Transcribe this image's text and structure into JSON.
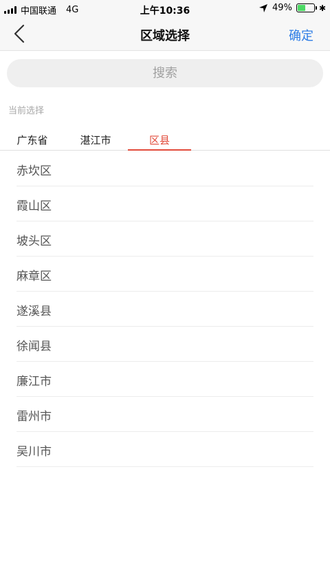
{
  "status_bar": {
    "carrier": "中国联通",
    "network": "4G",
    "time": "上午10:36",
    "battery": "49%",
    "battery_level": 0.49,
    "bluetooth": "✱"
  },
  "nav": {
    "title": "区域选择",
    "confirm_label": "确定",
    "back_icon": "chevron-left-icon"
  },
  "search": {
    "placeholder": "搜索",
    "value": ""
  },
  "section_label": "当前选择",
  "tabs": [
    {
      "label": "广东省",
      "active": false
    },
    {
      "label": "湛江市",
      "active": false
    },
    {
      "label": "区县",
      "active": true
    }
  ],
  "districts": [
    "赤坎区",
    "霞山区",
    "坡头区",
    "麻章区",
    "遂溪县",
    "徐闻县",
    "廉江市",
    "雷州市",
    "吴川市"
  ],
  "colors": {
    "accent_red": "#e24b3b",
    "confirm_blue": "#2d7ce6",
    "battery_green": "#4cd964"
  }
}
